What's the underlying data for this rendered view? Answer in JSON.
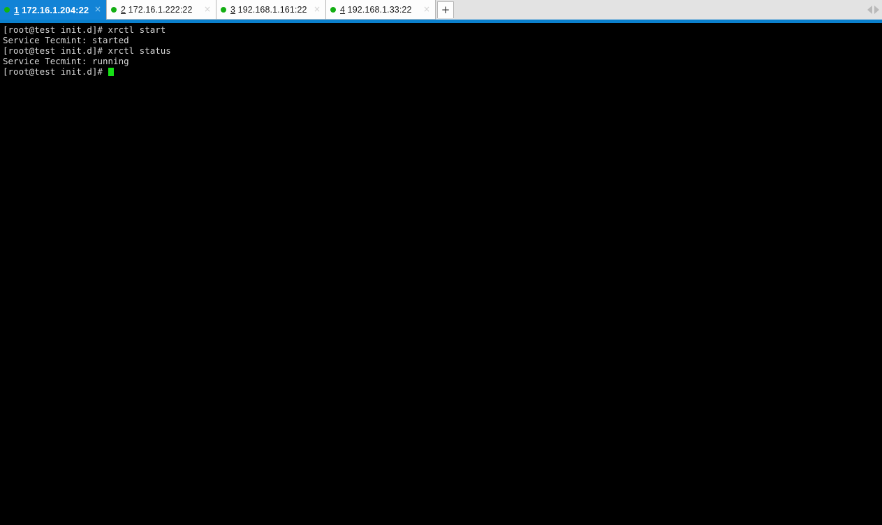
{
  "window": {
    "accent_color": "#0b80cd",
    "tabbar_background": "#e3e3e3",
    "terminal_background": "#000000",
    "terminal_text_color": "#d8d8d8",
    "cursor_color": "#16e016",
    "status_dot_color": "#13ae13",
    "active_tab_color": "#1283d6"
  },
  "tabs": [
    {
      "number": "1",
      "address": "172.16.1.204:22",
      "status": "connected",
      "active": true,
      "close_label": "×"
    },
    {
      "number": "2",
      "address": "172.16.1.222:22",
      "status": "connected",
      "active": false,
      "close_label": "×"
    },
    {
      "number": "3",
      "address": "192.168.1.161:22",
      "status": "connected",
      "active": false,
      "close_label": "×"
    },
    {
      "number": "4",
      "address": "192.168.1.33:22",
      "status": "connected",
      "active": false,
      "close_label": "×"
    }
  ],
  "new_tab_button": {
    "label": "+"
  },
  "tab_scrollers": {
    "left_label": "◀",
    "right_label": "▶"
  },
  "terminal": {
    "lines": [
      "[root@test init.d]# xrctl start",
      "Service Tecmint: started",
      "[root@test init.d]# xrctl status",
      "Service Tecmint: running"
    ],
    "prompt": "[root@test init.d]# "
  }
}
